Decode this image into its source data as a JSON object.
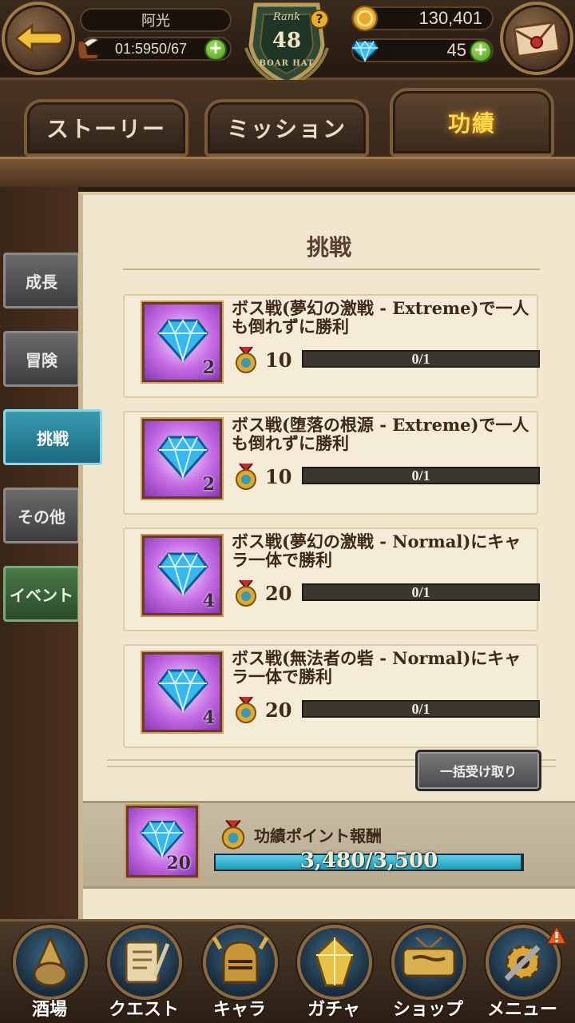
{
  "header": {
    "player_name": "阿光",
    "stamina_timer": "01:59",
    "stamina": "50/67",
    "gold": "130,401",
    "gems": "45",
    "rank_label": "Rank",
    "rank_value": "48",
    "rank_title": "BOAR HAT",
    "help_glyph": "?",
    "plus_glyph": "+"
  },
  "tabs": [
    {
      "label": "ストーリー",
      "active": false
    },
    {
      "label": "ミッション",
      "active": false
    },
    {
      "label": "功績",
      "active": true
    }
  ],
  "side_tabs": [
    {
      "label": "成長",
      "active": false
    },
    {
      "label": "冒険",
      "active": false
    },
    {
      "label": "挑戦",
      "active": true
    },
    {
      "label": "その他",
      "active": false
    },
    {
      "label": "イベント",
      "active": false
    }
  ],
  "panel": {
    "title": "挑戦",
    "achievements": [
      {
        "text": "ボス戦(夢幻の激戦 - Extreme)で一人も倒れずに勝利",
        "reward_icon": "diamond-gem-icon",
        "reward_count": "2",
        "points": "10",
        "progress": "0/1",
        "progress_fraction": 0
      },
      {
        "text": "ボス戦(堕落の根源 - Extreme)で一人も倒れずに勝利",
        "reward_icon": "diamond-gem-icon",
        "reward_count": "2",
        "points": "10",
        "progress": "0/1",
        "progress_fraction": 0
      },
      {
        "text": "ボス戦(夢幻の激戦 - Normal)にキャラ一体で勝利",
        "reward_icon": "diamond-gem-icon",
        "reward_count": "4",
        "points": "20",
        "progress": "0/1",
        "progress_fraction": 0
      },
      {
        "text": "ボス戦(無法者の砦 - Normal)にキャラ一体で勝利",
        "reward_icon": "diamond-gem-icon",
        "reward_count": "4",
        "points": "20",
        "progress": "0/1",
        "progress_fraction": 0
      }
    ],
    "claim_all_label": "一括受け取り",
    "total": {
      "reward_count": "20",
      "label": "功績ポイント報酬",
      "value": "3,480/3,500",
      "fraction": 0.9943
    }
  },
  "nav": [
    {
      "label": "酒場",
      "icon": "tavern-icon"
    },
    {
      "label": "クエスト",
      "icon": "quest-scroll-icon"
    },
    {
      "label": "キャラ",
      "icon": "knight-helmet-icon"
    },
    {
      "label": "ガチャ",
      "icon": "crystal-gacha-icon"
    },
    {
      "label": "ショップ",
      "icon": "shop-sign-icon"
    },
    {
      "label": "メニュー",
      "icon": "gear-icon",
      "alert": true
    }
  ],
  "colors": {
    "accent_gold": "#ffd84a",
    "active_side_tab": "#2a8aa4",
    "event_tab": "#3a6a3a",
    "parchment": "#f1e7cf",
    "progress_fill": "#3ab4d4"
  }
}
